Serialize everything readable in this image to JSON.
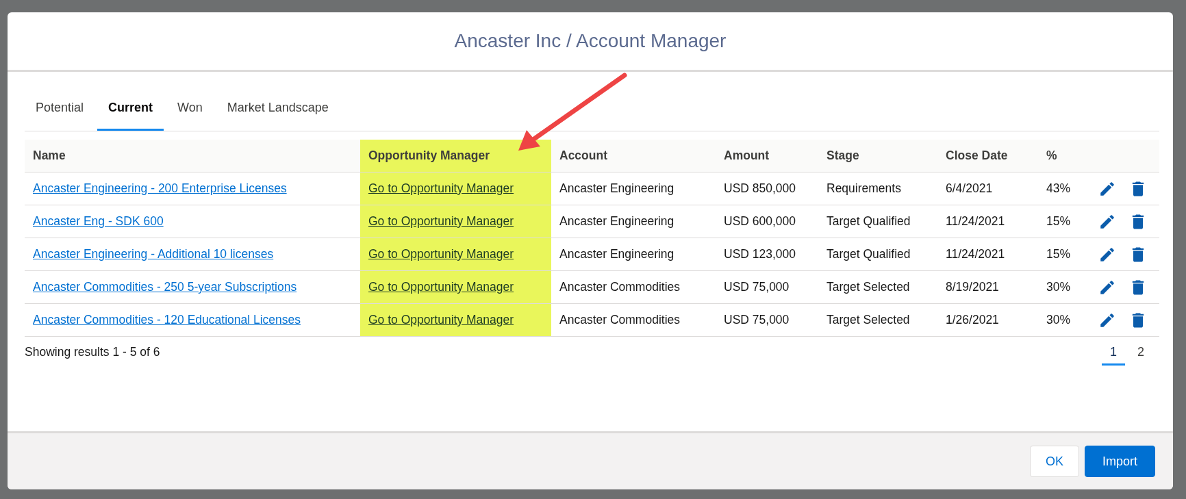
{
  "modal": {
    "title": "Ancaster Inc / Account Manager"
  },
  "tabs": [
    {
      "label": "Potential",
      "selected": false
    },
    {
      "label": "Current",
      "selected": true
    },
    {
      "label": "Won",
      "selected": false
    },
    {
      "label": "Market Landscape",
      "selected": false
    }
  ],
  "table": {
    "columns": [
      {
        "label": "Name",
        "highlighted": false
      },
      {
        "label": "Opportunity Manager",
        "highlighted": true
      },
      {
        "label": "Account",
        "highlighted": false
      },
      {
        "label": "Amount",
        "highlighted": false
      },
      {
        "label": "Stage",
        "highlighted": false
      },
      {
        "label": "Close Date",
        "highlighted": false
      },
      {
        "label": "%",
        "highlighted": false
      }
    ],
    "rows": [
      {
        "name": "Ancaster Engineering - 200 Enterprise Licenses",
        "manager_link": "Go to Opportunity Manager",
        "account": "Ancaster Engineering",
        "amount": "USD 850,000",
        "stage": "Requirements",
        "close_date": "6/4/2021",
        "percent": "43%"
      },
      {
        "name": "Ancaster Eng - SDK 600",
        "manager_link": "Go to Opportunity Manager",
        "account": "Ancaster Engineering",
        "amount": "USD 600,000",
        "stage": "Target Qualified",
        "close_date": "11/24/2021",
        "percent": "15%"
      },
      {
        "name": "Ancaster Engineering - Additional 10 licenses",
        "manager_link": "Go to Opportunity Manager",
        "account": "Ancaster Engineering",
        "amount": "USD 123,000",
        "stage": "Target Qualified",
        "close_date": "11/24/2021",
        "percent": "15%"
      },
      {
        "name": "Ancaster Commodities - 250 5-year Subscriptions",
        "manager_link": "Go to Opportunity Manager",
        "account": "Ancaster Commodities",
        "amount": "USD 75,000",
        "stage": "Target Selected",
        "close_date": "8/19/2021",
        "percent": "30%"
      },
      {
        "name": "Ancaster Commodities - 120 Educational Licenses",
        "manager_link": "Go to Opportunity Manager",
        "account": "Ancaster Commodities",
        "amount": "USD 75,000",
        "stage": "Target Selected",
        "close_date": "1/26/2021",
        "percent": "30%"
      }
    ]
  },
  "results_summary": "Showing results 1 - 5 of 6",
  "pagination": [
    {
      "label": "1",
      "selected": true
    },
    {
      "label": "2",
      "selected": false
    }
  ],
  "buttons": [
    {
      "label": "OK",
      "kind": "neutral"
    },
    {
      "label": "Import",
      "kind": "brand"
    }
  ]
}
